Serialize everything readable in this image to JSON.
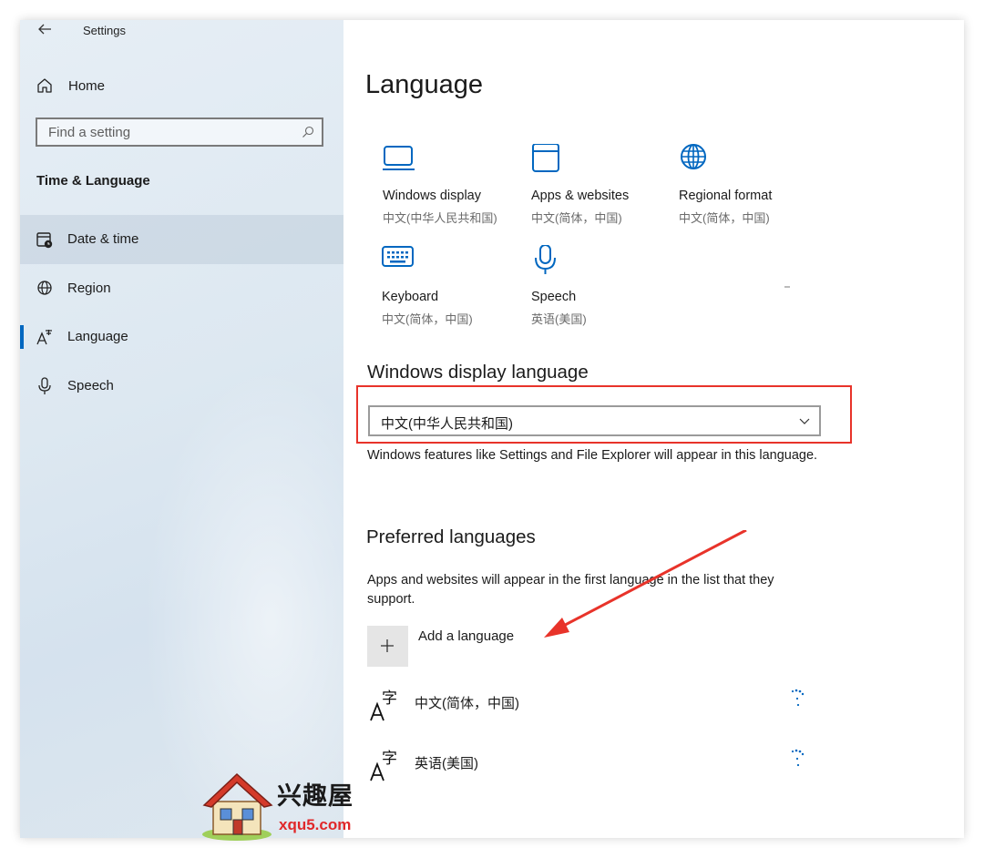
{
  "app": {
    "title": "Settings"
  },
  "sidebar": {
    "home_label": "Home",
    "search_placeholder": "Find a setting",
    "section_title": "Time & Language",
    "items": [
      {
        "label": "Date & time",
        "icon": "calendar-clock-icon"
      },
      {
        "label": "Region",
        "icon": "globe-icon"
      },
      {
        "label": "Language",
        "icon": "language-icon"
      },
      {
        "label": "Speech",
        "icon": "microphone-icon"
      }
    ]
  },
  "main": {
    "title": "Language",
    "tiles": [
      {
        "title": "Windows display",
        "subtitle": "中文(中华人民共和国)",
        "icon": "monitor-icon"
      },
      {
        "title": "Apps & websites",
        "subtitle": "中文(简体，中国)",
        "icon": "window-icon"
      },
      {
        "title": "Regional format",
        "subtitle": "中文(简体，中国)",
        "icon": "globe-icon"
      },
      {
        "title": "Keyboard",
        "subtitle": "中文(简体，中国)",
        "icon": "keyboard-icon"
      },
      {
        "title": "Speech",
        "subtitle": "英语(美国)",
        "icon": "microphone-icon"
      }
    ],
    "display_language": {
      "heading": "Windows display language",
      "selected": "中文(中华人民共和国)",
      "description": "Windows features like Settings and File Explorer will appear in this language."
    },
    "preferred": {
      "heading": "Preferred languages",
      "description": "Apps and websites will appear in the first language in the list that they support.",
      "add_label": "Add a language",
      "languages": [
        {
          "label": "中文(简体，中国)"
        },
        {
          "label": "英语(美国)"
        }
      ]
    }
  },
  "colors": {
    "accent": "#0067c0",
    "highlight": "#e8332a"
  },
  "watermark": {
    "name": "兴趣屋",
    "site": "xqu5.com"
  }
}
